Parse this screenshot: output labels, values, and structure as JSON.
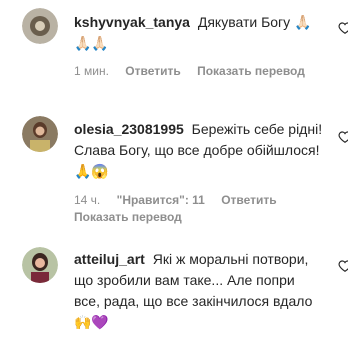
{
  "comments": [
    {
      "username": "kshyvnyak_tanya",
      "text": "Дякувати Богу 🙏🏻 🙏🏻🙏🏻",
      "time": "1 мин.",
      "reply": "Ответить",
      "translate": "Показать перевод"
    },
    {
      "username": "olesia_23081995",
      "text": "Бережіть себе рідні! Слава Богу, що все добре обійшлося! 🙏😱",
      "time": "14 ч.",
      "likes": "\"Нравится\": 11",
      "reply": "Ответить",
      "translate": "Показать перевод"
    },
    {
      "username": "atteiluj_art",
      "text": "Які ж моральні потвори, що зробили вам таке... Але попри все, рада, що все закінчилося вдало🙌💜"
    }
  ],
  "icons": {
    "heart": "heart-outline-icon"
  }
}
